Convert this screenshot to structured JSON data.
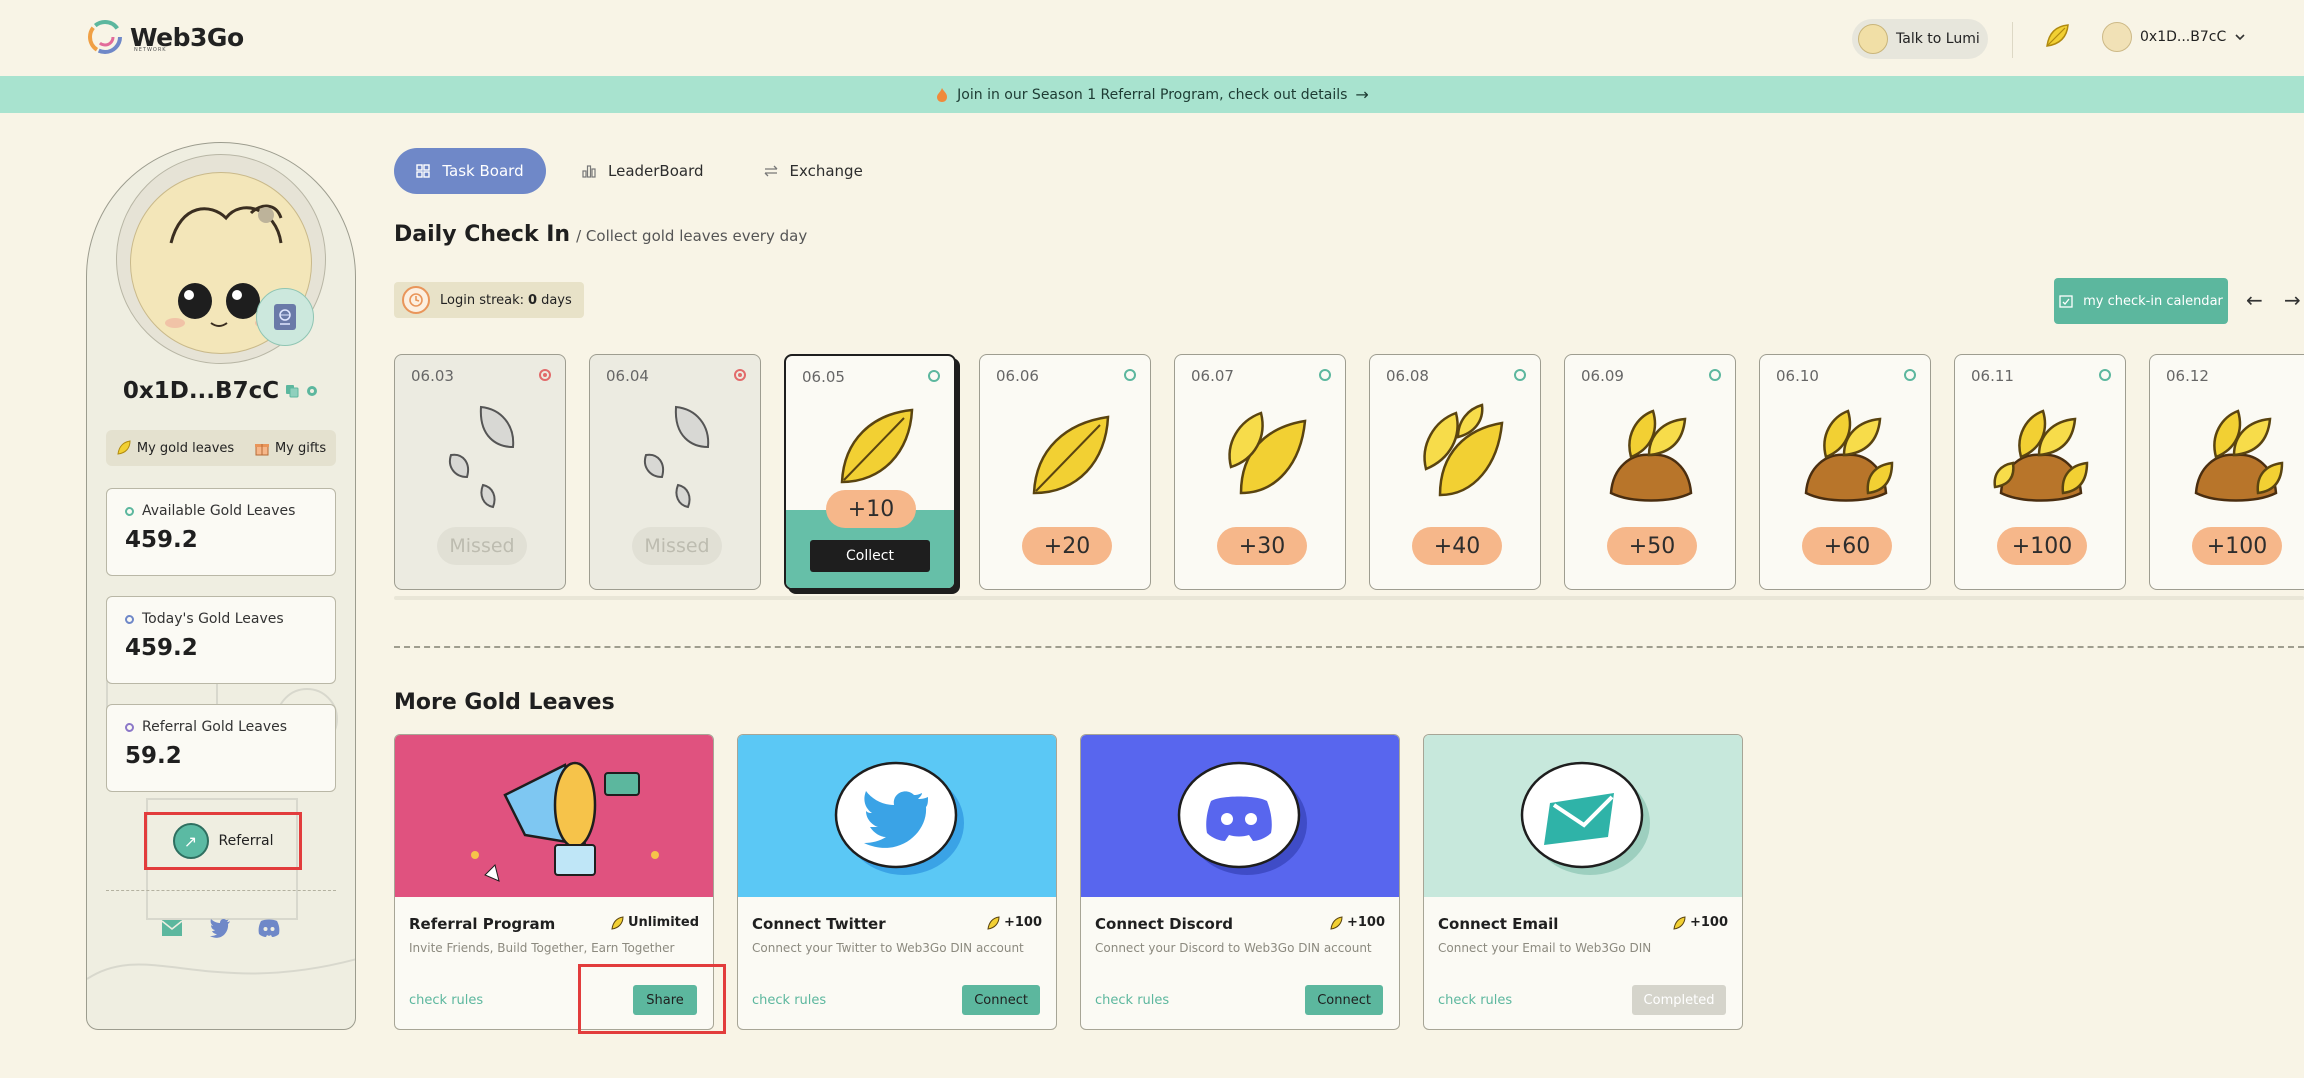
{
  "app": {
    "logo_text": "Web3Go",
    "logo_subtext": "NETWORK"
  },
  "header": {
    "talk_label": "Talk to Lumi",
    "user_address": "0x1D...B7cC"
  },
  "banner": {
    "text": "Join in our Season 1 Referral Program, check out details"
  },
  "sidebar": {
    "wallet_address": "0x1D...B7cC",
    "tabs": [
      {
        "label": "My gold leaves"
      },
      {
        "label": "My gifts"
      }
    ],
    "stats": [
      {
        "label": "Available Gold Leaves",
        "value": "459.2",
        "color": "#5cb79e"
      },
      {
        "label": "Today's Gold Leaves",
        "value": "459.2",
        "color": "#6f88c8"
      },
      {
        "label": "Referral Gold Leaves",
        "value": "59.2",
        "color": "#8c78c8"
      }
    ],
    "referral_label": "Referral"
  },
  "nav": {
    "tabs": [
      {
        "label": "Task Board",
        "active": true,
        "icon": "grid-icon"
      },
      {
        "label": "LeaderBoard",
        "active": false,
        "icon": "bar-chart-icon"
      },
      {
        "label": "Exchange",
        "active": false,
        "icon": "swap-icon"
      }
    ]
  },
  "checkin": {
    "title": "Daily Check In",
    "subtitle": "/ Collect gold leaves every day",
    "streak_label": "Login streak:",
    "streak_value": "0",
    "streak_unit": "days",
    "calendar_button": "my check-in calendar",
    "days": [
      {
        "date": "06.03",
        "reward": "Missed",
        "state": "missed"
      },
      {
        "date": "06.04",
        "reward": "Missed",
        "state": "missed"
      },
      {
        "date": "06.05",
        "reward": "+10",
        "state": "today",
        "action": "Collect"
      },
      {
        "date": "06.06",
        "reward": "+20",
        "state": "upcoming"
      },
      {
        "date": "06.07",
        "reward": "+30",
        "state": "upcoming"
      },
      {
        "date": "06.08",
        "reward": "+40",
        "state": "upcoming"
      },
      {
        "date": "06.09",
        "reward": "+50",
        "state": "upcoming"
      },
      {
        "date": "06.10",
        "reward": "+60",
        "state": "upcoming"
      },
      {
        "date": "06.11",
        "reward": "+100",
        "state": "upcoming"
      },
      {
        "date": "06.12",
        "reward": "+100",
        "state": "upcoming"
      }
    ]
  },
  "more": {
    "title": "More Gold Leaves",
    "tasks": [
      {
        "name": "Referral Program",
        "reward": "Unlimited",
        "desc": "Invite Friends, Build Together, Earn Together",
        "rules": "check rules",
        "button": "Share",
        "hero_color": "#e0527f"
      },
      {
        "name": "Connect Twitter",
        "reward": "+100",
        "desc": "Connect your Twitter to Web3Go DIN account",
        "rules": "check rules",
        "button": "Connect",
        "hero_color": "#5bc8f5"
      },
      {
        "name": "Connect Discord",
        "reward": "+100",
        "desc": "Connect your Discord to Web3Go DIN account",
        "rules": "check rules",
        "button": "Connect",
        "hero_color": "#5866ee"
      },
      {
        "name": "Connect Email",
        "reward": "+100",
        "desc": "Connect your Email to Web3Go DIN",
        "rules": "check rules",
        "button": "Completed",
        "hero_color": "#c7e8dc"
      }
    ]
  }
}
